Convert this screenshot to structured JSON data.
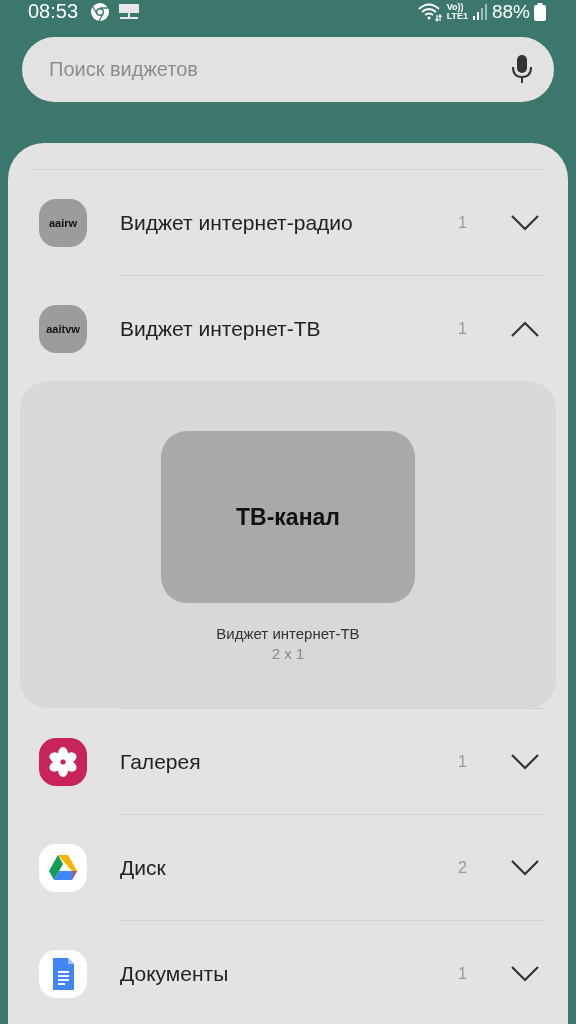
{
  "status_bar": {
    "time": "08:53",
    "volte": "Vo))",
    "network": "LTE1",
    "battery": "88%"
  },
  "search": {
    "placeholder": "Поиск виджетов"
  },
  "apps": [
    {
      "kind": "text",
      "icon_text": "aairw",
      "label": "Виджет интернет-радио",
      "count": "1",
      "expanded": false
    },
    {
      "kind": "text",
      "icon_text": "aaitvw",
      "label": "Виджет интернет-ТВ",
      "count": "1",
      "expanded": true,
      "widgets": [
        {
          "preview": "ТВ-канал",
          "name": "Виджет интернет-ТВ",
          "size": "2 x 1"
        }
      ]
    },
    {
      "kind": "gallery",
      "label": "Галерея",
      "count": "1",
      "expanded": false
    },
    {
      "kind": "drive",
      "label": "Диск",
      "count": "2",
      "expanded": false
    },
    {
      "kind": "docs",
      "label": "Документы",
      "count": "1",
      "expanded": false
    }
  ]
}
